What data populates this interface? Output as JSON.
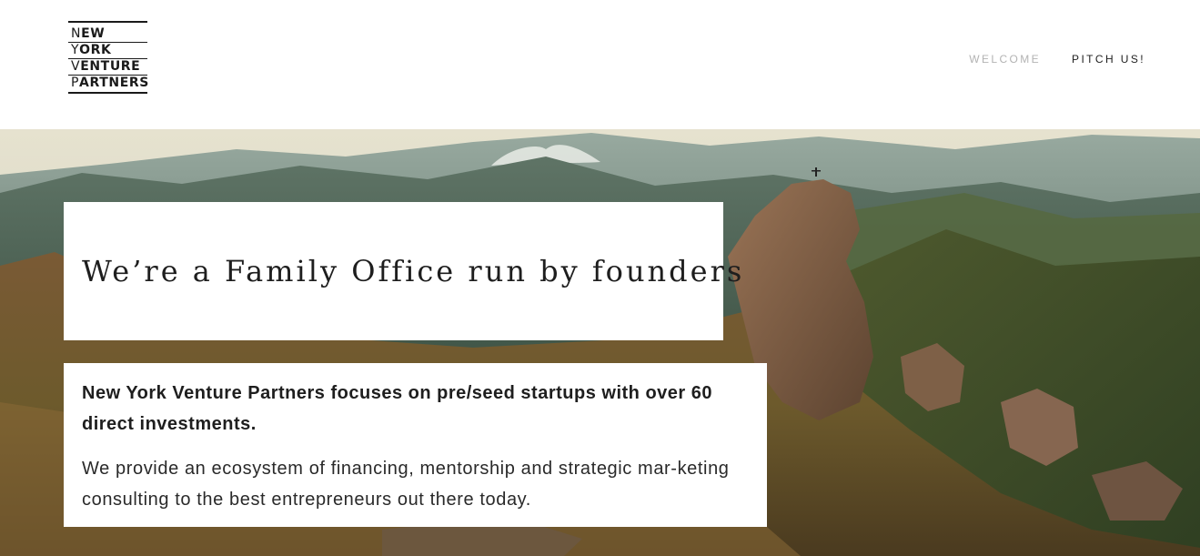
{
  "header": {
    "logo": {
      "lines": [
        {
          "initial": "N",
          "rest": "EW"
        },
        {
          "initial": "Y",
          "rest": "ORK"
        },
        {
          "initial": "V",
          "rest": "ENTURE"
        },
        {
          "initial": "P",
          "rest": "ARTNERS"
        }
      ]
    },
    "nav": {
      "welcome": "WELCOME",
      "pitch": "PITCH US!"
    }
  },
  "hero": {
    "title": "We’re a Family Office run by founders",
    "lead": "New York Venture Partners focuses on pre/seed startups with over 60 direct investments.",
    "body": "We provide an ecosystem of financing, mentorship and strategic mar-keting consulting to the best entrepreneurs out there today."
  },
  "colors": {
    "nav_muted": "#b3b3b3",
    "nav_active": "#1f1f1f",
    "text": "#1e1e1e"
  }
}
